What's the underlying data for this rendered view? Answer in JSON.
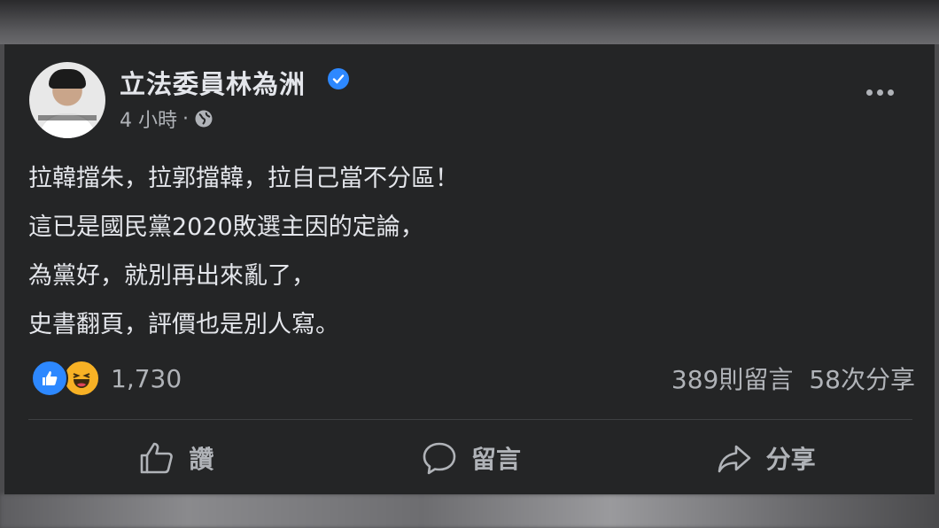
{
  "post": {
    "author": "立法委員林為洲",
    "time": "4 小時",
    "separator": "·",
    "privacy_icon": "globe-icon",
    "lines": [
      "拉韓擋朱，拉郭擋韓，拉自己當不分區！",
      "這已是國民黨2020敗選主因的定論，",
      "為黨好，就別再出來亂了，",
      "史書翻頁，評價也是別人寫。"
    ],
    "reactions": {
      "icons": [
        "like-icon",
        "haha-icon"
      ],
      "count": "1,730"
    },
    "comments": "389則留言",
    "shares": "58次分享"
  },
  "actions": {
    "like_label": "讚",
    "comment_label": "留言",
    "share_label": "分享"
  },
  "colors": {
    "card_bg": "#242526",
    "text": "#e4e6eb",
    "secondary": "#b0b3b8",
    "accent": "#2d88ff"
  }
}
